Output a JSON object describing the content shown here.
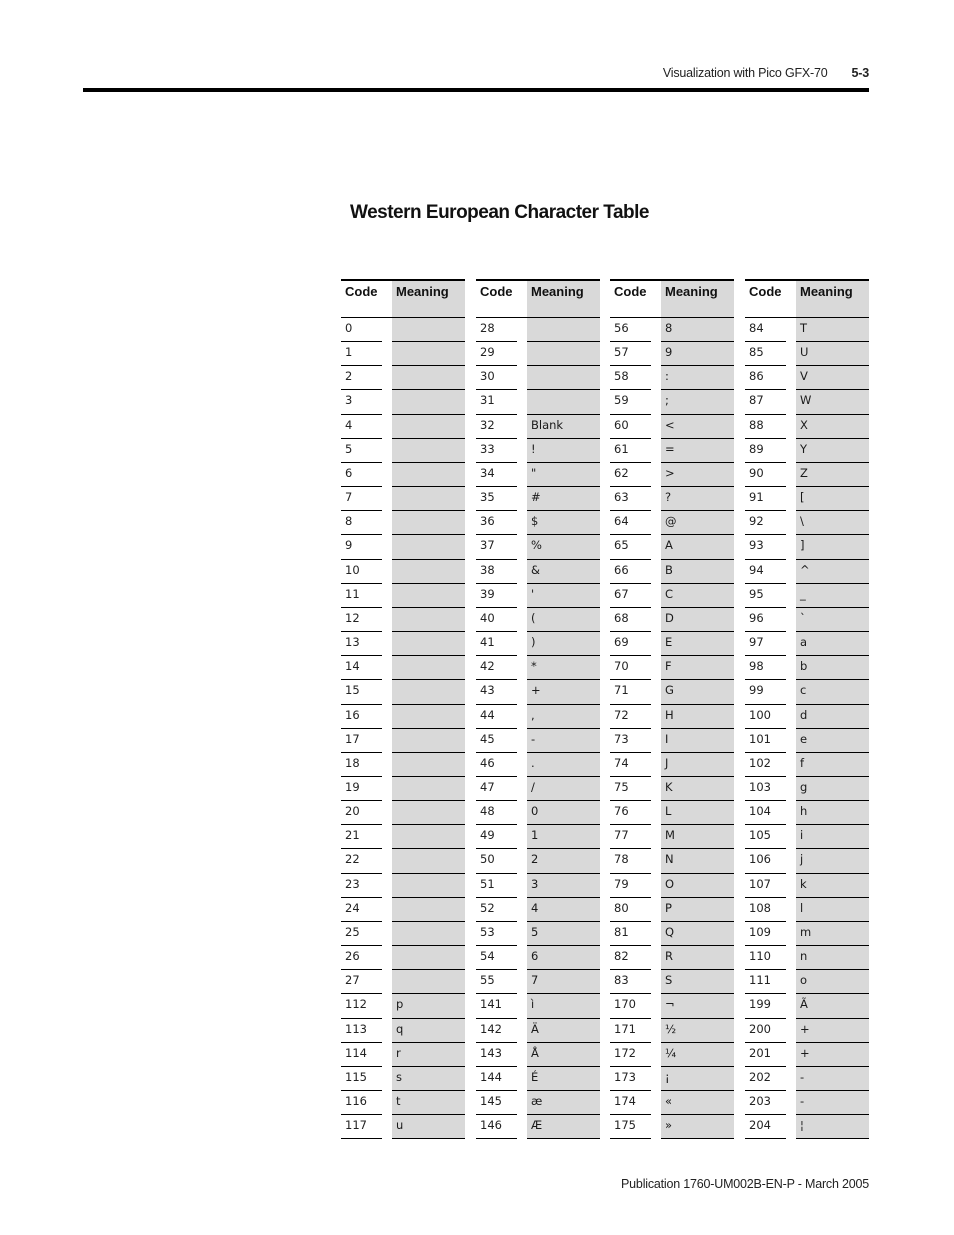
{
  "running_head": {
    "title": "Visualization with Pico GFX-70",
    "section": "5-3"
  },
  "page_title": "Western European Character Table",
  "table": {
    "headers": {
      "code": "Code",
      "meaning": "Meaning"
    },
    "groups": [
      {
        "rows": [
          {
            "code": "0",
            "meaning": ""
          },
          {
            "code": "1",
            "meaning": ""
          },
          {
            "code": "2",
            "meaning": ""
          },
          {
            "code": "3",
            "meaning": ""
          },
          {
            "code": "4",
            "meaning": ""
          },
          {
            "code": "5",
            "meaning": ""
          },
          {
            "code": "6",
            "meaning": ""
          },
          {
            "code": "7",
            "meaning": ""
          },
          {
            "code": "8",
            "meaning": ""
          },
          {
            "code": "9",
            "meaning": ""
          },
          {
            "code": "10",
            "meaning": ""
          },
          {
            "code": "11",
            "meaning": ""
          },
          {
            "code": "12",
            "meaning": ""
          },
          {
            "code": "13",
            "meaning": ""
          },
          {
            "code": "14",
            "meaning": ""
          },
          {
            "code": "15",
            "meaning": ""
          },
          {
            "code": "16",
            "meaning": ""
          },
          {
            "code": "17",
            "meaning": ""
          },
          {
            "code": "18",
            "meaning": ""
          },
          {
            "code": "19",
            "meaning": ""
          },
          {
            "code": "20",
            "meaning": ""
          },
          {
            "code": "21",
            "meaning": ""
          },
          {
            "code": "22",
            "meaning": ""
          },
          {
            "code": "23",
            "meaning": ""
          },
          {
            "code": "24",
            "meaning": ""
          },
          {
            "code": "25",
            "meaning": ""
          },
          {
            "code": "26",
            "meaning": ""
          },
          {
            "code": "27",
            "meaning": ""
          },
          {
            "code": "112",
            "meaning": "p"
          },
          {
            "code": "113",
            "meaning": "q"
          },
          {
            "code": "114",
            "meaning": "r"
          },
          {
            "code": "115",
            "meaning": "s"
          },
          {
            "code": "116",
            "meaning": "t"
          },
          {
            "code": "117",
            "meaning": "u"
          }
        ]
      },
      {
        "rows": [
          {
            "code": "28",
            "meaning": ""
          },
          {
            "code": "29",
            "meaning": ""
          },
          {
            "code": "30",
            "meaning": ""
          },
          {
            "code": "31",
            "meaning": ""
          },
          {
            "code": "32",
            "meaning": "Blank"
          },
          {
            "code": "33",
            "meaning": "!"
          },
          {
            "code": "34",
            "meaning": "\""
          },
          {
            "code": "35",
            "meaning": "#"
          },
          {
            "code": "36",
            "meaning": "$"
          },
          {
            "code": "37",
            "meaning": "%"
          },
          {
            "code": "38",
            "meaning": "&"
          },
          {
            "code": "39",
            "meaning": "'"
          },
          {
            "code": "40",
            "meaning": "("
          },
          {
            "code": "41",
            "meaning": ")"
          },
          {
            "code": "42",
            "meaning": "*"
          },
          {
            "code": "43",
            "meaning": "+"
          },
          {
            "code": "44",
            "meaning": ","
          },
          {
            "code": "45",
            "meaning": "-"
          },
          {
            "code": "46",
            "meaning": "."
          },
          {
            "code": "47",
            "meaning": "/"
          },
          {
            "code": "48",
            "meaning": "0"
          },
          {
            "code": "49",
            "meaning": "1"
          },
          {
            "code": "50",
            "meaning": "2"
          },
          {
            "code": "51",
            "meaning": "3"
          },
          {
            "code": "52",
            "meaning": "4"
          },
          {
            "code": "53",
            "meaning": "5"
          },
          {
            "code": "54",
            "meaning": "6"
          },
          {
            "code": "55",
            "meaning": "7"
          },
          {
            "code": "141",
            "meaning": "ì"
          },
          {
            "code": "142",
            "meaning": "Ä"
          },
          {
            "code": "143",
            "meaning": "Å"
          },
          {
            "code": "144",
            "meaning": "É"
          },
          {
            "code": "145",
            "meaning": "æ"
          },
          {
            "code": "146",
            "meaning": "Æ"
          }
        ]
      },
      {
        "rows": [
          {
            "code": "56",
            "meaning": "8"
          },
          {
            "code": "57",
            "meaning": "9"
          },
          {
            "code": "58",
            "meaning": ":"
          },
          {
            "code": "59",
            "meaning": ";"
          },
          {
            "code": "60",
            "meaning": "<"
          },
          {
            "code": "61",
            "meaning": "="
          },
          {
            "code": "62",
            "meaning": ">"
          },
          {
            "code": "63",
            "meaning": "?"
          },
          {
            "code": "64",
            "meaning": "@"
          },
          {
            "code": "65",
            "meaning": "A"
          },
          {
            "code": "66",
            "meaning": "B"
          },
          {
            "code": "67",
            "meaning": "C"
          },
          {
            "code": "68",
            "meaning": "D"
          },
          {
            "code": "69",
            "meaning": "E"
          },
          {
            "code": "70",
            "meaning": "F"
          },
          {
            "code": "71",
            "meaning": "G"
          },
          {
            "code": "72",
            "meaning": "H"
          },
          {
            "code": "73",
            "meaning": "I"
          },
          {
            "code": "74",
            "meaning": "J"
          },
          {
            "code": "75",
            "meaning": "K"
          },
          {
            "code": "76",
            "meaning": "L"
          },
          {
            "code": "77",
            "meaning": "M"
          },
          {
            "code": "78",
            "meaning": "N"
          },
          {
            "code": "79",
            "meaning": "O"
          },
          {
            "code": "80",
            "meaning": "P"
          },
          {
            "code": "81",
            "meaning": "Q"
          },
          {
            "code": "82",
            "meaning": "R"
          },
          {
            "code": "83",
            "meaning": "S"
          },
          {
            "code": "170",
            "meaning": "¬"
          },
          {
            "code": "171",
            "meaning": "½"
          },
          {
            "code": "172",
            "meaning": "¼"
          },
          {
            "code": "173",
            "meaning": "¡"
          },
          {
            "code": "174",
            "meaning": "«"
          },
          {
            "code": "175",
            "meaning": "»"
          }
        ]
      },
      {
        "rows": [
          {
            "code": "84",
            "meaning": "T"
          },
          {
            "code": "85",
            "meaning": "U"
          },
          {
            "code": "86",
            "meaning": "V"
          },
          {
            "code": "87",
            "meaning": "W"
          },
          {
            "code": "88",
            "meaning": "X"
          },
          {
            "code": "89",
            "meaning": "Y"
          },
          {
            "code": "90",
            "meaning": "Z"
          },
          {
            "code": "91",
            "meaning": "["
          },
          {
            "code": "92",
            "meaning": "\\"
          },
          {
            "code": "93",
            "meaning": "]"
          },
          {
            "code": "94",
            "meaning": "^"
          },
          {
            "code": "95",
            "meaning": "_"
          },
          {
            "code": "96",
            "meaning": "`"
          },
          {
            "code": "97",
            "meaning": "a"
          },
          {
            "code": "98",
            "meaning": "b"
          },
          {
            "code": "99",
            "meaning": "c"
          },
          {
            "code": "100",
            "meaning": "d"
          },
          {
            "code": "101",
            "meaning": "e"
          },
          {
            "code": "102",
            "meaning": "f"
          },
          {
            "code": "103",
            "meaning": "g"
          },
          {
            "code": "104",
            "meaning": "h"
          },
          {
            "code": "105",
            "meaning": "i"
          },
          {
            "code": "106",
            "meaning": "j"
          },
          {
            "code": "107",
            "meaning": "k"
          },
          {
            "code": "108",
            "meaning": "l"
          },
          {
            "code": "109",
            "meaning": "m"
          },
          {
            "code": "110",
            "meaning": "n"
          },
          {
            "code": "111",
            "meaning": "o"
          },
          {
            "code": "199",
            "meaning": "Ã"
          },
          {
            "code": "200",
            "meaning": "+"
          },
          {
            "code": "201",
            "meaning": "+"
          },
          {
            "code": "202",
            "meaning": "-"
          },
          {
            "code": "203",
            "meaning": "-"
          },
          {
            "code": "204",
            "meaning": "¦"
          }
        ]
      }
    ]
  },
  "footer": {
    "publication": "Publication 1760-UM002B-EN-P - March 2005"
  },
  "colors": {
    "meaning_column_bg": "#d9d9d9",
    "rule": "#000000"
  }
}
